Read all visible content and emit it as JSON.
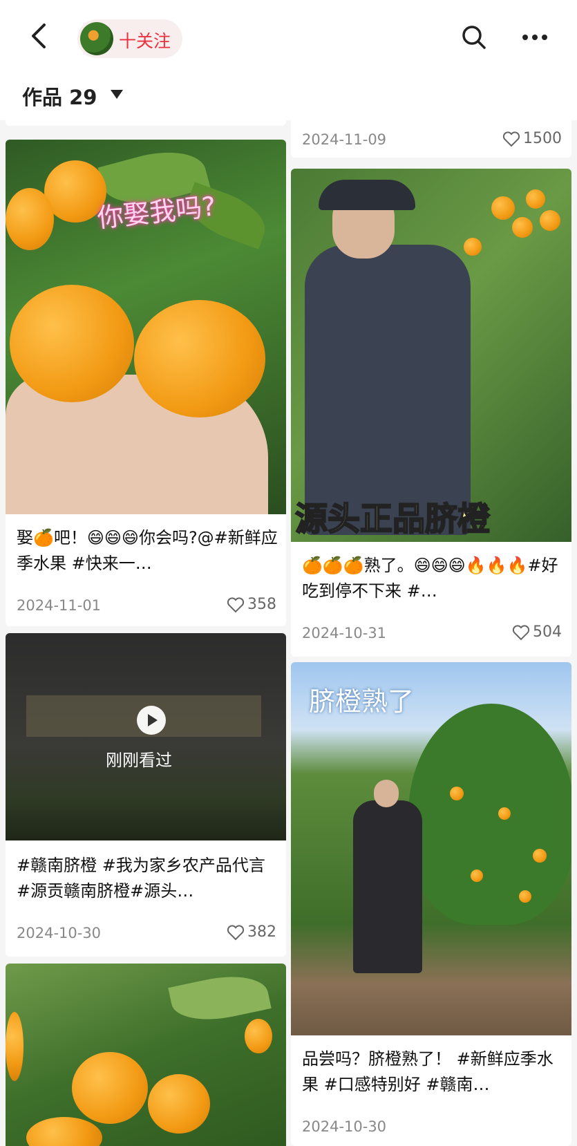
{
  "header": {
    "follow_label": "十关注",
    "icons": {
      "back": "chevron-left-icon",
      "search": "search-icon",
      "more": "more-dots-icon"
    }
  },
  "works": {
    "label": "作品 29"
  },
  "cards": {
    "top_right": {
      "date": "2024-11-09",
      "likes": "1500"
    },
    "c1": {
      "overlay": "你娶我吗?",
      "caption": "娶🍊吧！😄😄😄你会吗?@#新鲜应季水果 #快来一…",
      "date": "2024-11-01",
      "likes": "358"
    },
    "c2": {
      "overlay": "源头正品脐橙",
      "caption": "🍊🍊🍊熟了。😄😄😄🔥🔥🔥#好吃到停不下来 #…",
      "date": "2024-10-31",
      "likes": "504"
    },
    "c3": {
      "watched": "刚刚看过",
      "caption": "#赣南脐橙 #我为家乡农产品代言 #源贡赣南脐橙#源头…",
      "date": "2024-10-30",
      "likes": "382"
    },
    "c4": {
      "overlay": "脐橙熟了",
      "caption": "品尝吗？脐橙熟了！ #新鲜应季水果 #口感特别好 #赣南…",
      "date": "2024-10-30"
    }
  },
  "colors": {
    "accent": "#e8323f",
    "card_bg": "#ffffff",
    "page_bg": "#f5f5f5"
  }
}
